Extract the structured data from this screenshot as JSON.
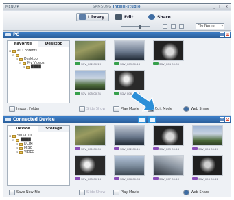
{
  "app": {
    "menu_label": "MENU ▾",
    "brand": "SAMSUNG ",
    "brand_bold": "Intelli-studio",
    "win_buttons": [
      "_",
      "□",
      "x"
    ]
  },
  "toolbar": {
    "library": "Library",
    "edit": "Edit",
    "share": "Share",
    "sort_value": "File Name"
  },
  "pc_panel": {
    "title": "PC",
    "tabs": [
      "Favorite",
      "Desktop"
    ],
    "tree": [
      {
        "label": "All Contents",
        "indent": 0
      },
      {
        "label": "C",
        "indent": 1
      },
      {
        "label": "Desktop",
        "indent": 2
      },
      {
        "label": "My Videos",
        "indent": 3
      },
      {
        "label": "████",
        "indent": 4
      }
    ],
    "thumbs": [
      {
        "label": "SDV_002  00:23",
        "badge": "green"
      },
      {
        "label": "SDV_003  00:18",
        "badge": "green"
      },
      {
        "label": "SDV_004  00:09",
        "badge": "green"
      },
      {
        "label": "SDV_005  00:31",
        "badge": "green"
      },
      {
        "label": "SDV_006  00:12",
        "badge": "green"
      }
    ],
    "footer": {
      "import": "Import Folder",
      "slide": "Slide Show",
      "play": "Play Movie",
      "edit": "Edit Mode",
      "web": "Web Share"
    }
  },
  "device_panel": {
    "title": "Connected Device",
    "tabs": [
      "Device",
      "Storage"
    ],
    "tree": [
      {
        "label": "SMX-C10",
        "indent": 0
      },
      {
        "label": "████",
        "indent": 1
      },
      {
        "label": "DCIM",
        "indent": 2
      },
      {
        "label": "MISC",
        "indent": 2
      },
      {
        "label": "VIDEO",
        "indent": 2
      }
    ],
    "thumbs": [
      {
        "label": "SDV_001  00:09",
        "badge": "purple"
      },
      {
        "label": "SDV_002  00:11",
        "badge": "purple"
      },
      {
        "label": "SDV_003  00:14",
        "badge": "purple"
      },
      {
        "label": "SDV_004  00:20",
        "badge": "purple"
      },
      {
        "label": "SDV_005  00:16",
        "badge": "purple"
      },
      {
        "label": "SDV_006  00:08",
        "badge": "purple"
      },
      {
        "label": "SDV_007  00:13",
        "badge": "purple"
      },
      {
        "label": "SDV_008  00:22",
        "badge": "purple"
      }
    ],
    "footer": {
      "save": "Save New File",
      "slide": "Slide Show",
      "play": "Play Movie",
      "web": "Web Share"
    }
  },
  "colors": {
    "accent": "#2c8fd8",
    "panel_header": "#3d7fc9",
    "badge_pc": "#37a04c",
    "badge_device": "#8a4fb8"
  }
}
